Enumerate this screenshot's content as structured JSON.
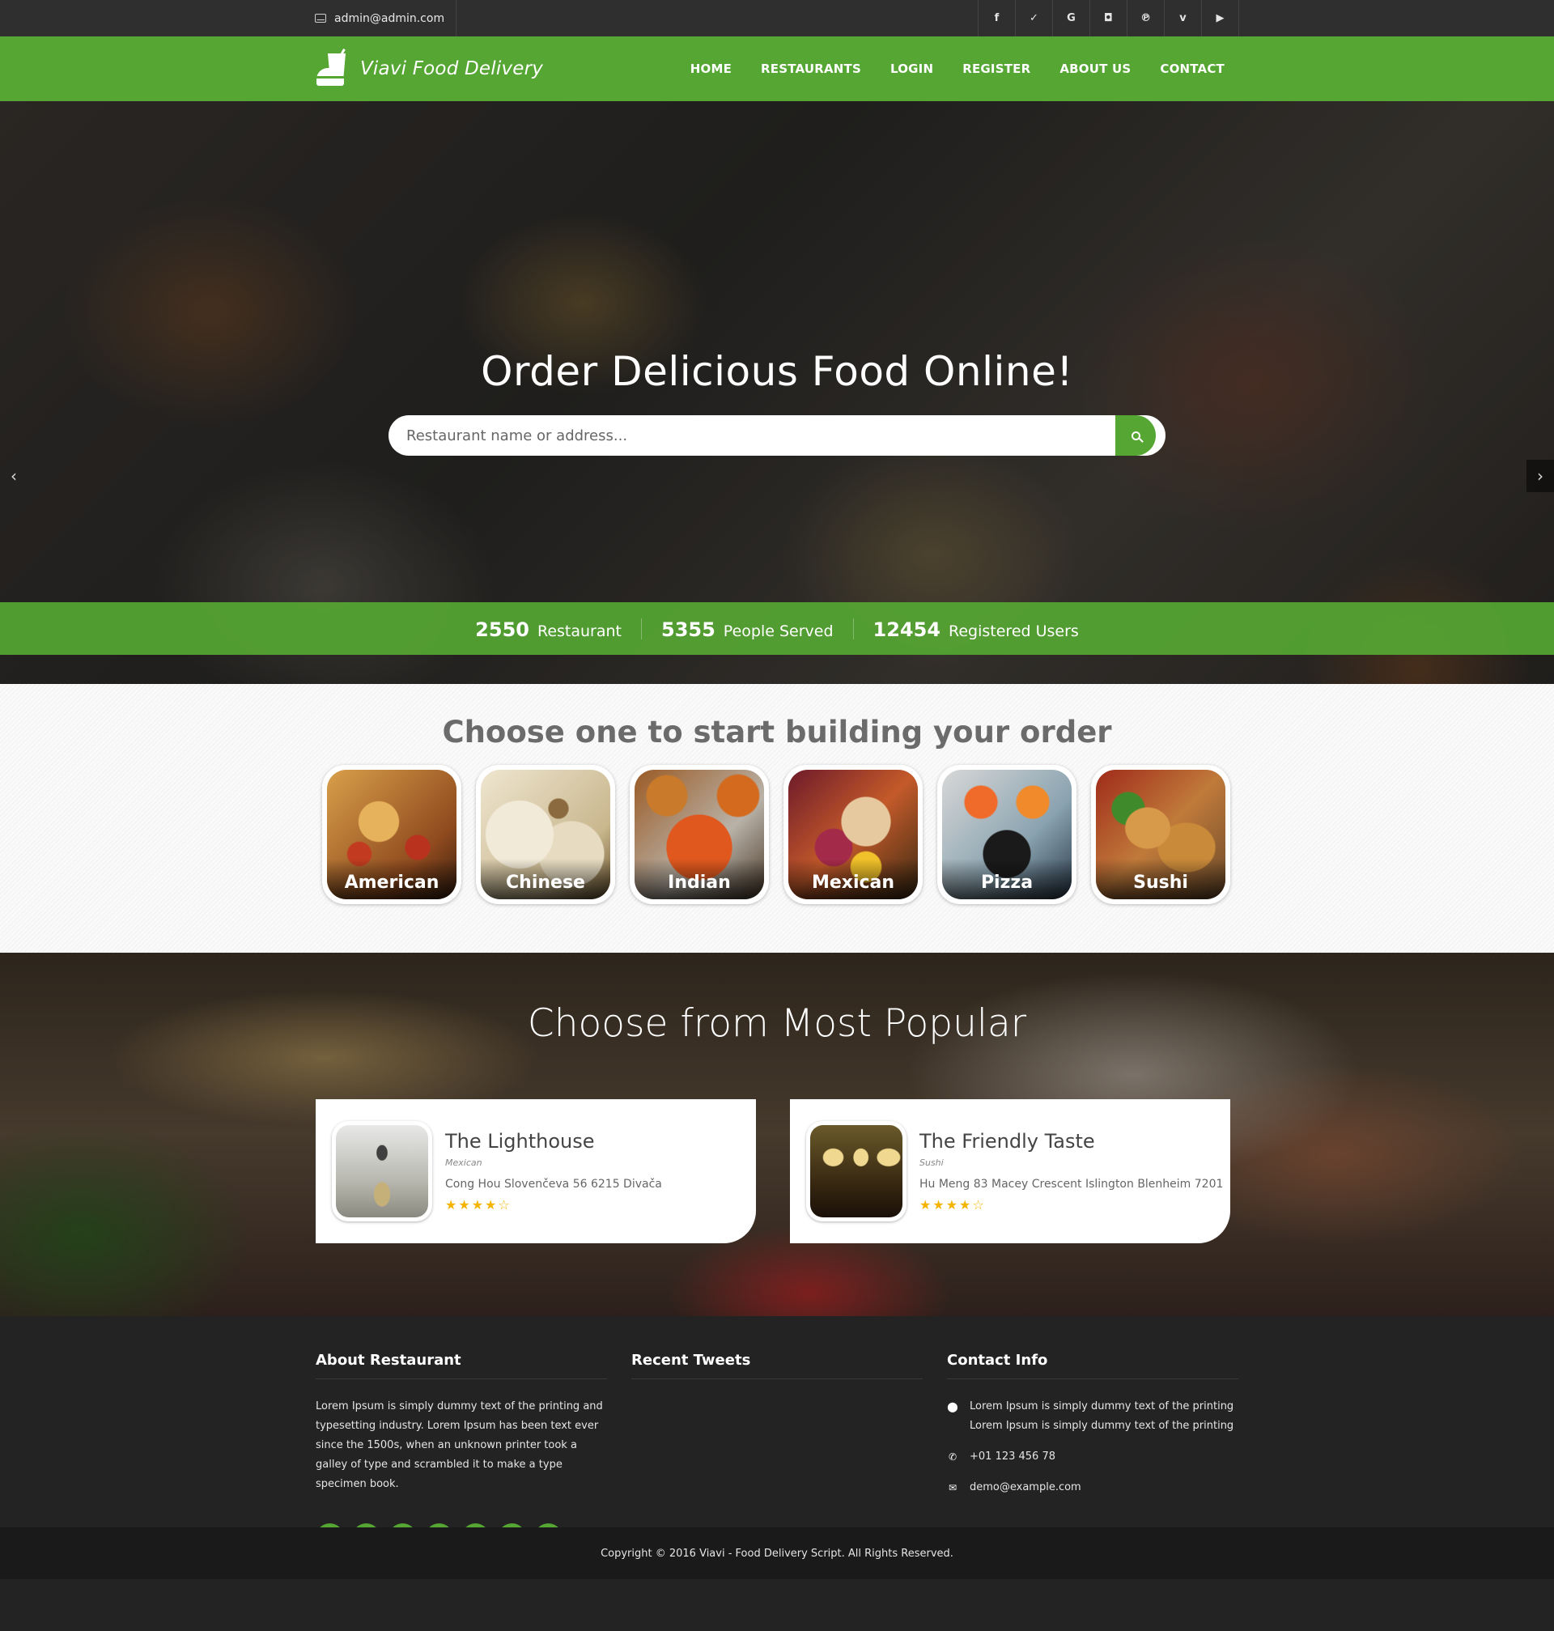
{
  "topbar": {
    "email": "admin@admin.com",
    "social": [
      {
        "icon": "facebook-icon",
        "glyph": "f"
      },
      {
        "icon": "twitter-icon",
        "glyph": "✓"
      },
      {
        "icon": "google-icon",
        "glyph": "G"
      },
      {
        "icon": "instagram-icon",
        "glyph": "◘"
      },
      {
        "icon": "pinterest-icon",
        "glyph": "℗"
      },
      {
        "icon": "vimeo-icon",
        "glyph": "v"
      },
      {
        "icon": "youtube-icon",
        "glyph": "▶"
      }
    ]
  },
  "nav": {
    "brand": "Viavi Food Delivery",
    "items": [
      "HOME",
      "RESTAURANTS",
      "LOGIN",
      "REGISTER",
      "ABOUT US",
      "CONTACT"
    ]
  },
  "hero": {
    "title": "Order Delicious Food Online!",
    "search_placeholder": "Restaurant name or address...",
    "prev": "‹",
    "next": "›"
  },
  "stats": [
    {
      "num": "2550",
      "label": "Restaurant"
    },
    {
      "num": "5355",
      "label": "People Served"
    },
    {
      "num": "12454",
      "label": "Registered Users"
    }
  ],
  "categories": {
    "title": "Choose one to start building your order",
    "items": [
      "American",
      "Chinese",
      "Indian",
      "Mexican",
      "Pizza",
      "Sushi"
    ]
  },
  "popular": {
    "title": "Choose from Most Popular",
    "cards": [
      {
        "name": "The Lighthouse",
        "cuisine": "Mexican",
        "address": "Cong Hou Slovenčeva 56 6215 Divača",
        "stars": "★★★★☆",
        "rating": 4
      },
      {
        "name": "The Friendly Taste",
        "cuisine": "Sushi",
        "address": "Hu Meng 83 Macey Crescent Islington Blenheim 7201",
        "stars": "★★★★☆",
        "rating": 4
      }
    ]
  },
  "footer": {
    "about_title": "About Restaurant",
    "about_text": "Lorem Ipsum is simply dummy text of the printing and typesetting industry. Lorem Ipsum has been text ever since the 1500s, when an unknown printer took a galley of type and scrambled it to make a type specimen book.",
    "tweets_title": "Recent Tweets",
    "contact_title": "Contact Info",
    "address": "Lorem Ipsum is simply dummy text of the printing Lorem Ipsum is simply dummy text of the printing",
    "phone": "+01 123 456 78",
    "email": "demo@example.com",
    "copyright": "Copyright © 2016 Viavi - Food Delivery Script. All Rights Reserved."
  }
}
